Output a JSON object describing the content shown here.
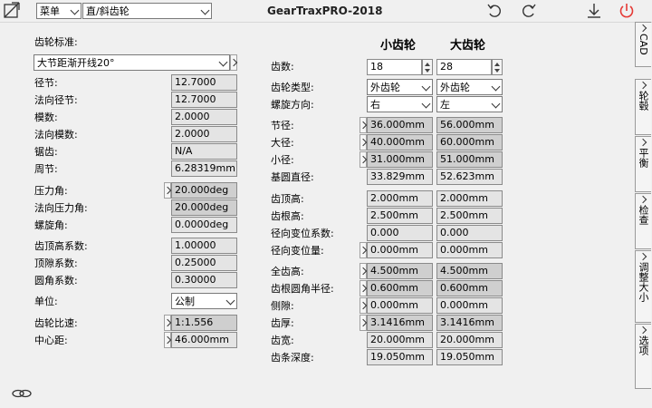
{
  "toolbar": {
    "menu_label": "菜单",
    "gear_type": "直/斜齿轮",
    "app_title": "GearTraxPRO-2018"
  },
  "left": {
    "standard_label": "齿轮标准:",
    "standard_value": "大节距渐开线20°",
    "rows": [
      {
        "label": "径节:",
        "value": "12.7000"
      },
      {
        "label": "法向径节:",
        "value": "12.7000"
      },
      {
        "label": "模数:",
        "value": "2.0000"
      },
      {
        "label": "法向模数:",
        "value": "2.0000"
      },
      {
        "label": "锯齿:",
        "value": "N/A"
      },
      {
        "label": "周节:",
        "value": "6.28319mm"
      },
      {
        "label": "压力角:",
        "value": "20.000deg"
      },
      {
        "label": "法向压力角:",
        "value": "20.000deg"
      },
      {
        "label": "螺旋角:",
        "value": "0.0000deg"
      },
      {
        "label": "齿顶高系数:",
        "value": "1.00000"
      },
      {
        "label": "顶隙系数:",
        "value": "0.25000"
      },
      {
        "label": "圆角系数:",
        "value": "0.30000"
      }
    ],
    "units_label": "单位:",
    "units_value": "公制",
    "ratio_label": "齿轮比速:",
    "ratio_value": "1:1.556",
    "center_label": "中心距:",
    "center_value": "46.000mm"
  },
  "right": {
    "pinion_header": "小齿轮",
    "gear_header": "大齿轮",
    "teeth_label": "齿数:",
    "teeth": [
      "18",
      "28"
    ],
    "type_label": "齿轮类型:",
    "types": [
      "外齿轮",
      "外齿轮"
    ],
    "hand_label": "螺旋方向:",
    "hands": [
      "右",
      "左"
    ],
    "rows": [
      {
        "label": "节径:",
        "v1": "36.000mm",
        "v2": "56.000mm"
      },
      {
        "label": "大径:",
        "v1": "40.000mm",
        "v2": "60.000mm"
      },
      {
        "label": "小径:",
        "v1": "31.000mm",
        "v2": "51.000mm"
      },
      {
        "label": "基圆直径:",
        "v1": "33.829mm",
        "v2": "52.623mm"
      },
      {
        "label": "齿顶高:",
        "v1": "2.000mm",
        "v2": "2.000mm"
      },
      {
        "label": "齿根高:",
        "v1": "2.500mm",
        "v2": "2.500mm"
      },
      {
        "label": "径向变位系数:",
        "v1": "0.000",
        "v2": "0.000"
      },
      {
        "label": "径向变位量:",
        "v1": "0.000mm",
        "v2": "0.000mm"
      },
      {
        "label": "全齿高:",
        "v1": "4.500mm",
        "v2": "4.500mm"
      },
      {
        "label": "齿根圆角半径:",
        "v1": "0.600mm",
        "v2": "0.600mm"
      },
      {
        "label": "侧隙:",
        "v1": "0.000mm",
        "v2": "0.000mm"
      },
      {
        "label": "齿厚:",
        "v1": "3.1416mm",
        "v2": "3.1416mm"
      },
      {
        "label": "齿宽:",
        "v1": "20.000mm",
        "v2": "20.000mm"
      },
      {
        "label": "齿条深度:",
        "v1": "19.050mm",
        "v2": "19.050mm"
      }
    ]
  },
  "sidetabs": [
    {
      "label": "CAD"
    },
    {
      "label": "轮毂"
    },
    {
      "label": "平衡"
    },
    {
      "label": "检查"
    },
    {
      "label": "调整大小"
    },
    {
      "label": "选项"
    }
  ],
  "icons": {
    "undo": "undo-icon",
    "redo": "redo-icon",
    "download": "download-icon",
    "power": "power-icon",
    "link": "link-icon"
  },
  "colors": {
    "power": "#e53935",
    "panel": "#f0f0f0",
    "field": "#e4e4e4"
  }
}
